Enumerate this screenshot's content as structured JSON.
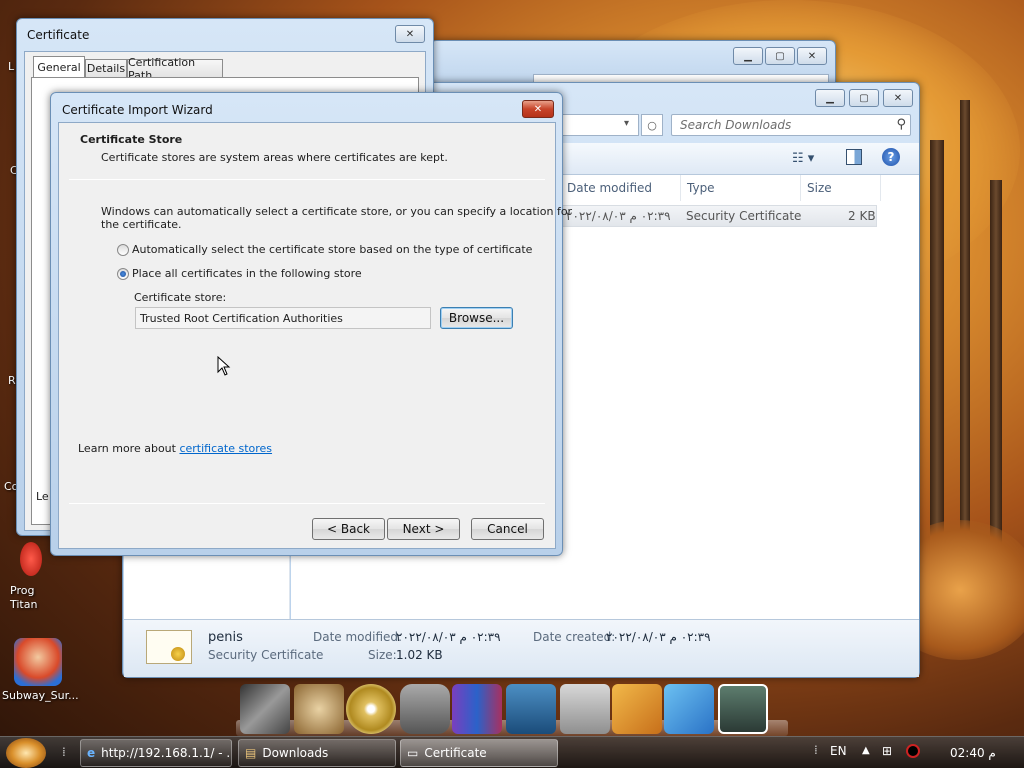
{
  "desktop": {
    "icons": [
      {
        "label": "Prog\nTitan"
      },
      {
        "label": "Subway_Sur..."
      }
    ],
    "edge_letters": [
      "L",
      "C",
      "R",
      "Co"
    ]
  },
  "cert_window": {
    "title": "Certificate",
    "tabs": [
      "General",
      "Details",
      "Certification Path"
    ],
    "partial_text": "Le"
  },
  "explorer_back": {
    "title": ""
  },
  "explorer": {
    "search_placeholder": "Search Downloads",
    "columns": [
      "Date modified",
      "Type",
      "Size"
    ],
    "file_row": {
      "date": "٠٢:٣٩ م ٢٠٢٢/٠٨/٠٣",
      "type": "Security Certificate",
      "size": "2 KB"
    },
    "details": {
      "name": "penis",
      "type": "Security Certificate",
      "date_modified_label": "Date modified:",
      "date_modified": "٠٢:٣٩ م ٢٠٢٢/٠٨/٠٣",
      "date_created_label": "Date created:",
      "date_created": "٠٢:٣٩ م ٢٠٢٢/٠٨/٠٣",
      "size_label": "Size:",
      "size": "1.02 KB"
    }
  },
  "wizard": {
    "title": "Certificate Import Wizard",
    "section_title": "Certificate Store",
    "section_desc": "Certificate stores are system areas where certificates are kept.",
    "intro_line1": "Windows can automatically select a certificate store, or you can specify a location for",
    "intro_line2": "the certificate.",
    "radio_auto": "Automatically select the certificate store based on the type of certificate",
    "radio_place": "Place all certificates in the following store",
    "store_label": "Certificate store:",
    "store_value": "Trusted Root Certification Authorities",
    "browse": "Browse...",
    "learn_prefix": "Learn more about ",
    "learn_link": "certificate stores",
    "back": "< Back",
    "next": "Next >",
    "cancel": "Cancel"
  },
  "taskbar": {
    "buttons": [
      {
        "label": "http://192.168.1.1/ - ..."
      },
      {
        "label": "Downloads"
      },
      {
        "label": "Certificate"
      }
    ],
    "lang": "EN",
    "clock": "02:40 م"
  },
  "colors": {
    "link": "#0066cc",
    "accent": "#3a6ea5"
  }
}
